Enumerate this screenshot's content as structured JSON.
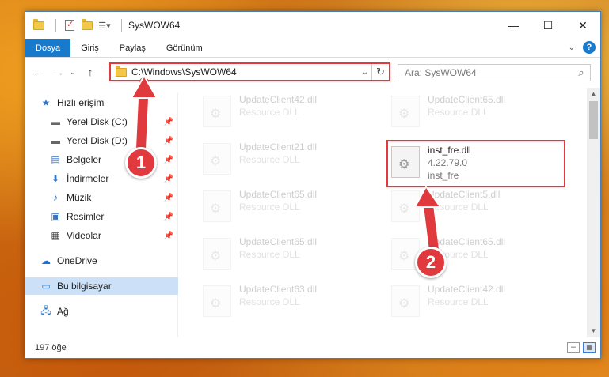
{
  "window": {
    "title": "SysWOW64",
    "controls": {
      "minimize": "—",
      "maximize": "☐",
      "close": "✕"
    }
  },
  "ribbon": {
    "tabs": [
      {
        "label": "Dosya",
        "active": true
      },
      {
        "label": "Giriş"
      },
      {
        "label": "Paylaş"
      },
      {
        "label": "Görünüm"
      }
    ],
    "help": "?"
  },
  "nav": {
    "back": "←",
    "forward": "→",
    "recent": "⌄",
    "up": "↑",
    "address": "C:\\Windows\\SysWOW64",
    "search_placeholder": "Ara: SysWOW64"
  },
  "sidebar": {
    "items": [
      {
        "label": "Hızlı erişim",
        "icon": "star-icon",
        "pinned": false
      },
      {
        "label": "Yerel Disk (C:)",
        "icon": "drive-icon",
        "pinned": true
      },
      {
        "label": "Yerel Disk (D:)",
        "icon": "drive-icon",
        "pinned": true
      },
      {
        "label": "Belgeler",
        "icon": "documents-icon",
        "pinned": true
      },
      {
        "label": "İndirmeler",
        "icon": "download-icon",
        "pinned": true
      },
      {
        "label": "Müzik",
        "icon": "music-icon",
        "pinned": true
      },
      {
        "label": "Resimler",
        "icon": "pictures-icon",
        "pinned": true
      },
      {
        "label": "Videolar",
        "icon": "videos-icon",
        "pinned": true
      },
      {
        "label": "OneDrive",
        "icon": "onedrive-icon",
        "pinned": false
      },
      {
        "label": "Bu bilgisayar",
        "icon": "computer-icon",
        "pinned": false,
        "selected": true
      },
      {
        "label": "Ağ",
        "icon": "network-icon",
        "pinned": false
      }
    ]
  },
  "files": [
    {
      "name": "UpdateClient42.dll",
      "desc": "Resource DLL",
      "faded": true
    },
    {
      "name": "UpdateClient65.dll",
      "desc": "Resource DLL",
      "faded": true
    },
    {
      "name": "UpdateClient21.dll",
      "desc": "Resource DLL",
      "faded": true
    },
    {
      "name": "inst_fre.dll",
      "version": "4.22.79.0",
      "desc": "inst_fre",
      "faded": false,
      "highlight": true
    },
    {
      "name": "UpdateClient65.dll",
      "desc": "Resource DLL",
      "faded": true
    },
    {
      "name": "UpdateClient5.dll",
      "desc": "Resource DLL",
      "faded": true
    },
    {
      "name": "UpdateClient65.dll",
      "desc": "Resource DLL",
      "faded": true
    },
    {
      "name": "UpdateClient65.dll",
      "desc": "Resource DLL",
      "faded": true
    },
    {
      "name": "UpdateClient63.dll",
      "desc": "Resource DLL",
      "faded": true
    },
    {
      "name": "UpdateClient42.dll",
      "desc": "Resource DLL",
      "faded": true
    }
  ],
  "status": {
    "count": "197 öğe"
  },
  "annotations": [
    {
      "label": "1"
    },
    {
      "label": "2"
    }
  ],
  "colors": {
    "accent": "#1979ca",
    "highlight": "#e0393e",
    "selected": "#cce0f7"
  }
}
